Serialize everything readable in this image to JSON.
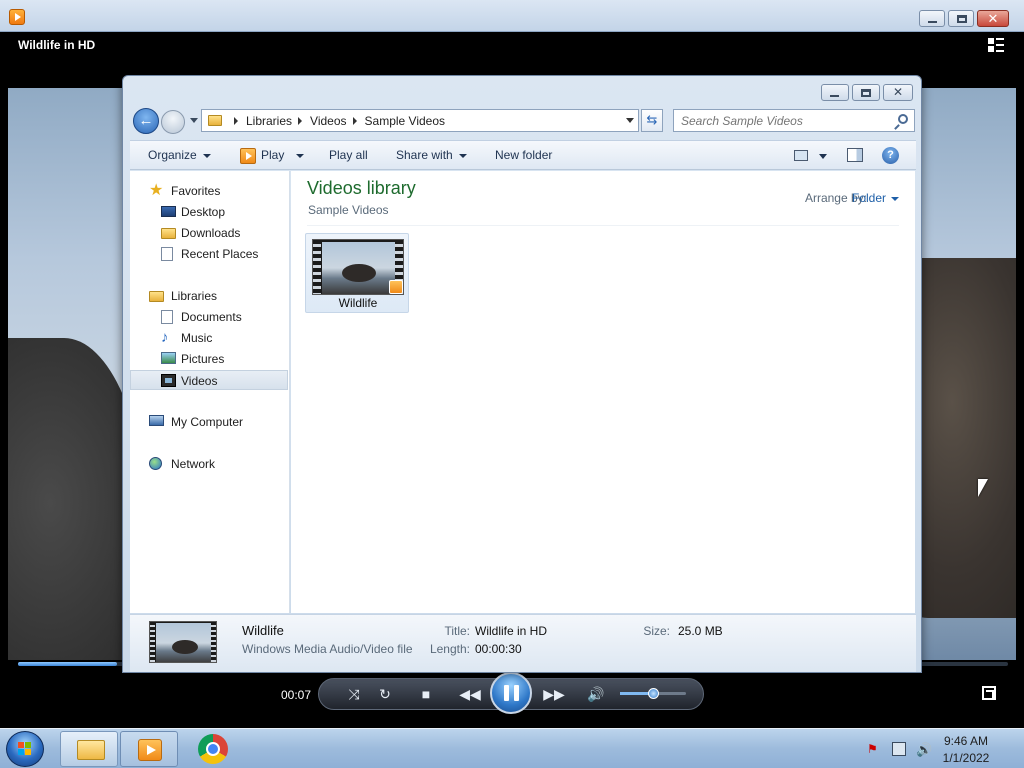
{
  "wmp": {
    "title": "Wildlife in HD",
    "time": "00:07",
    "progress_fraction": 0.1,
    "volume_fraction": 0.5
  },
  "explorer": {
    "breadcrumb": [
      "Libraries",
      "Videos",
      "Sample Videos"
    ],
    "search_placeholder": "Search Sample Videos",
    "toolbar": {
      "organize": "Organize",
      "play": "Play",
      "play_all": "Play all",
      "share_with": "Share with",
      "new_folder": "New folder"
    },
    "nav": {
      "favorites": "Favorites",
      "desktop": "Desktop",
      "downloads": "Downloads",
      "recent_places": "Recent Places",
      "libraries": "Libraries",
      "documents": "Documents",
      "music": "Music",
      "pictures": "Pictures",
      "videos": "Videos",
      "my_computer": "My Computer",
      "network": "Network"
    },
    "content": {
      "title": "Videos library",
      "subtitle": "Sample Videos",
      "arrange_label": "Arrange by:",
      "arrange_value": "Folder",
      "files": [
        {
          "name": "Wildlife"
        }
      ]
    },
    "details": {
      "name": "Wildlife",
      "type": "Windows Media Audio/Video file",
      "title_label": "Title:",
      "title_value": "Wildlife in HD",
      "length_label": "Length:",
      "length_value": "00:00:30",
      "size_label": "Size:",
      "size_value": "25.0 MB"
    }
  },
  "taskbar": {
    "clock_time": "9:46 AM",
    "clock_date": "1/1/2022"
  }
}
